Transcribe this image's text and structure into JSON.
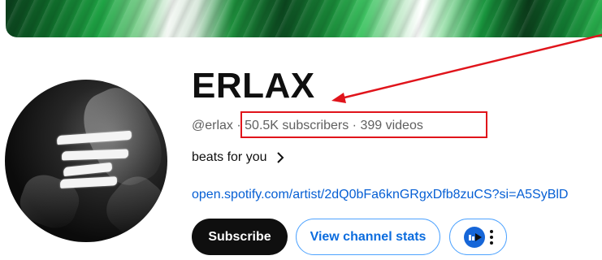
{
  "channel": {
    "name": "ERLAX",
    "handle": "@erlax",
    "separator": "·",
    "subscribers": "50.5K subscribers",
    "videos": "399 videos",
    "description": "beats for you",
    "link": "open.spotify.com/artist/2dQ0bFa6knGRgxDfb8zuCS?si=A5SyBlD"
  },
  "buttons": {
    "subscribe": "Subscribe",
    "view_stats": "View channel stats"
  },
  "icons": {
    "description_more": "chevron-right-icon",
    "extension": "extension-logo-icon",
    "more": "more-vertical-icon"
  },
  "annotation": {
    "color": "#e0141b"
  }
}
